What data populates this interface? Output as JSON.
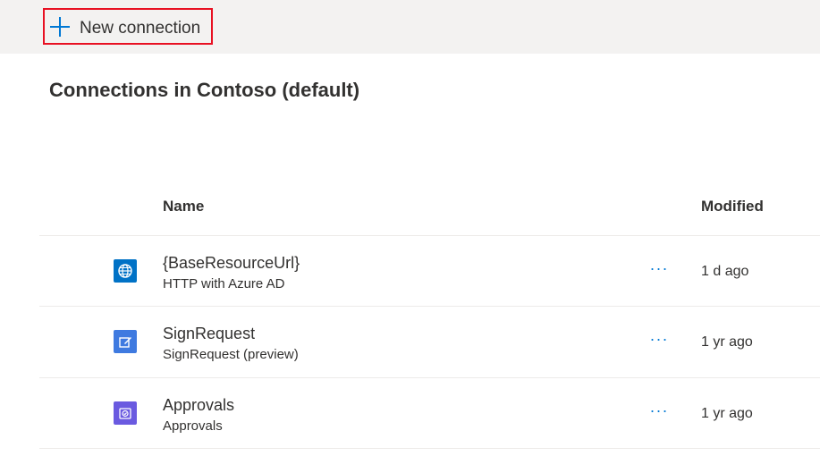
{
  "toolbar": {
    "new_connection_label": "New connection"
  },
  "page": {
    "title": "Connections in Contoso (default)"
  },
  "table": {
    "columns": {
      "name": "Name",
      "modified": "Modified"
    },
    "more_glyph": "···",
    "rows": [
      {
        "title": "{BaseResourceUrl}",
        "subtitle": "HTTP with Azure AD",
        "modified": "1 d ago",
        "icon": "globe-icon",
        "icon_color": "#0072c6"
      },
      {
        "title": "SignRequest",
        "subtitle": "SignRequest (preview)",
        "modified": "1 yr ago",
        "icon": "sign-edit-icon",
        "icon_color": "#3f7ae0"
      },
      {
        "title": "Approvals",
        "subtitle": "Approvals",
        "modified": "1 yr ago",
        "icon": "approvals-icon",
        "icon_color": "#6a5ae0"
      }
    ]
  },
  "colors": {
    "accent": "#0078d4",
    "highlight_border": "#e81123",
    "command_bar_bg": "#f3f2f1"
  }
}
